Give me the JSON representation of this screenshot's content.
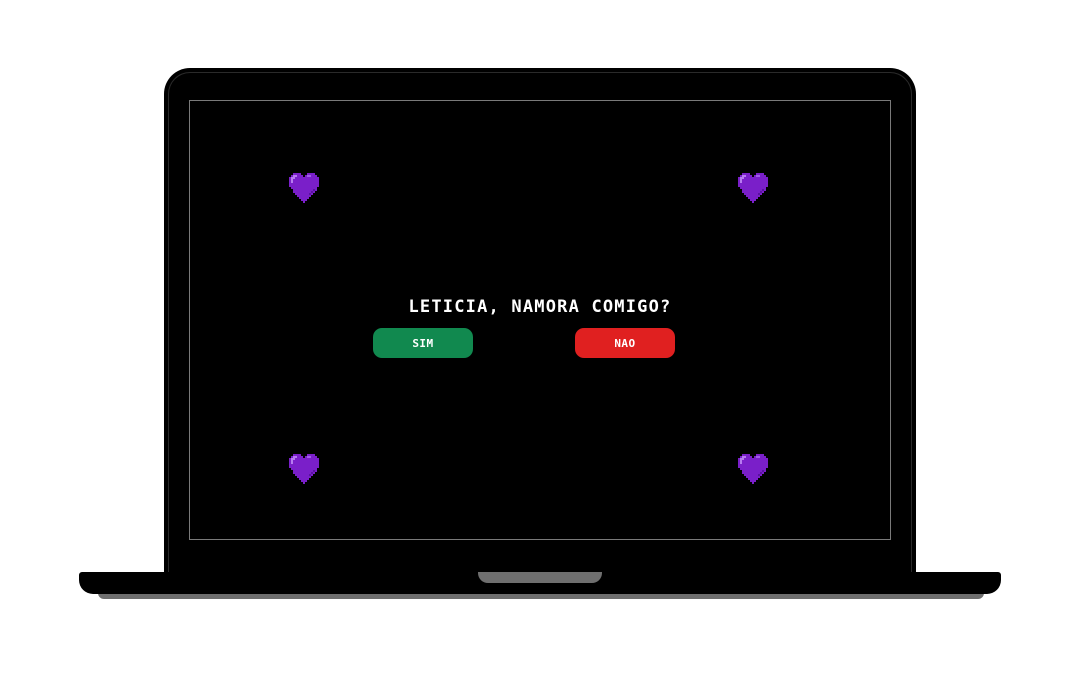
{
  "proposal": {
    "question": "LETICIA, NAMORA COMIGO?",
    "yes_label": "SIM",
    "no_label": "NAO"
  },
  "colors": {
    "screen_background": "#000000",
    "heart": "#7a1fc9",
    "yes_button": "#11894f",
    "no_button": "#e02020",
    "text": "#ffffff"
  },
  "decorations": {
    "hearts": [
      "purple-heart-icon",
      "purple-heart-icon",
      "purple-heart-icon",
      "purple-heart-icon"
    ]
  }
}
